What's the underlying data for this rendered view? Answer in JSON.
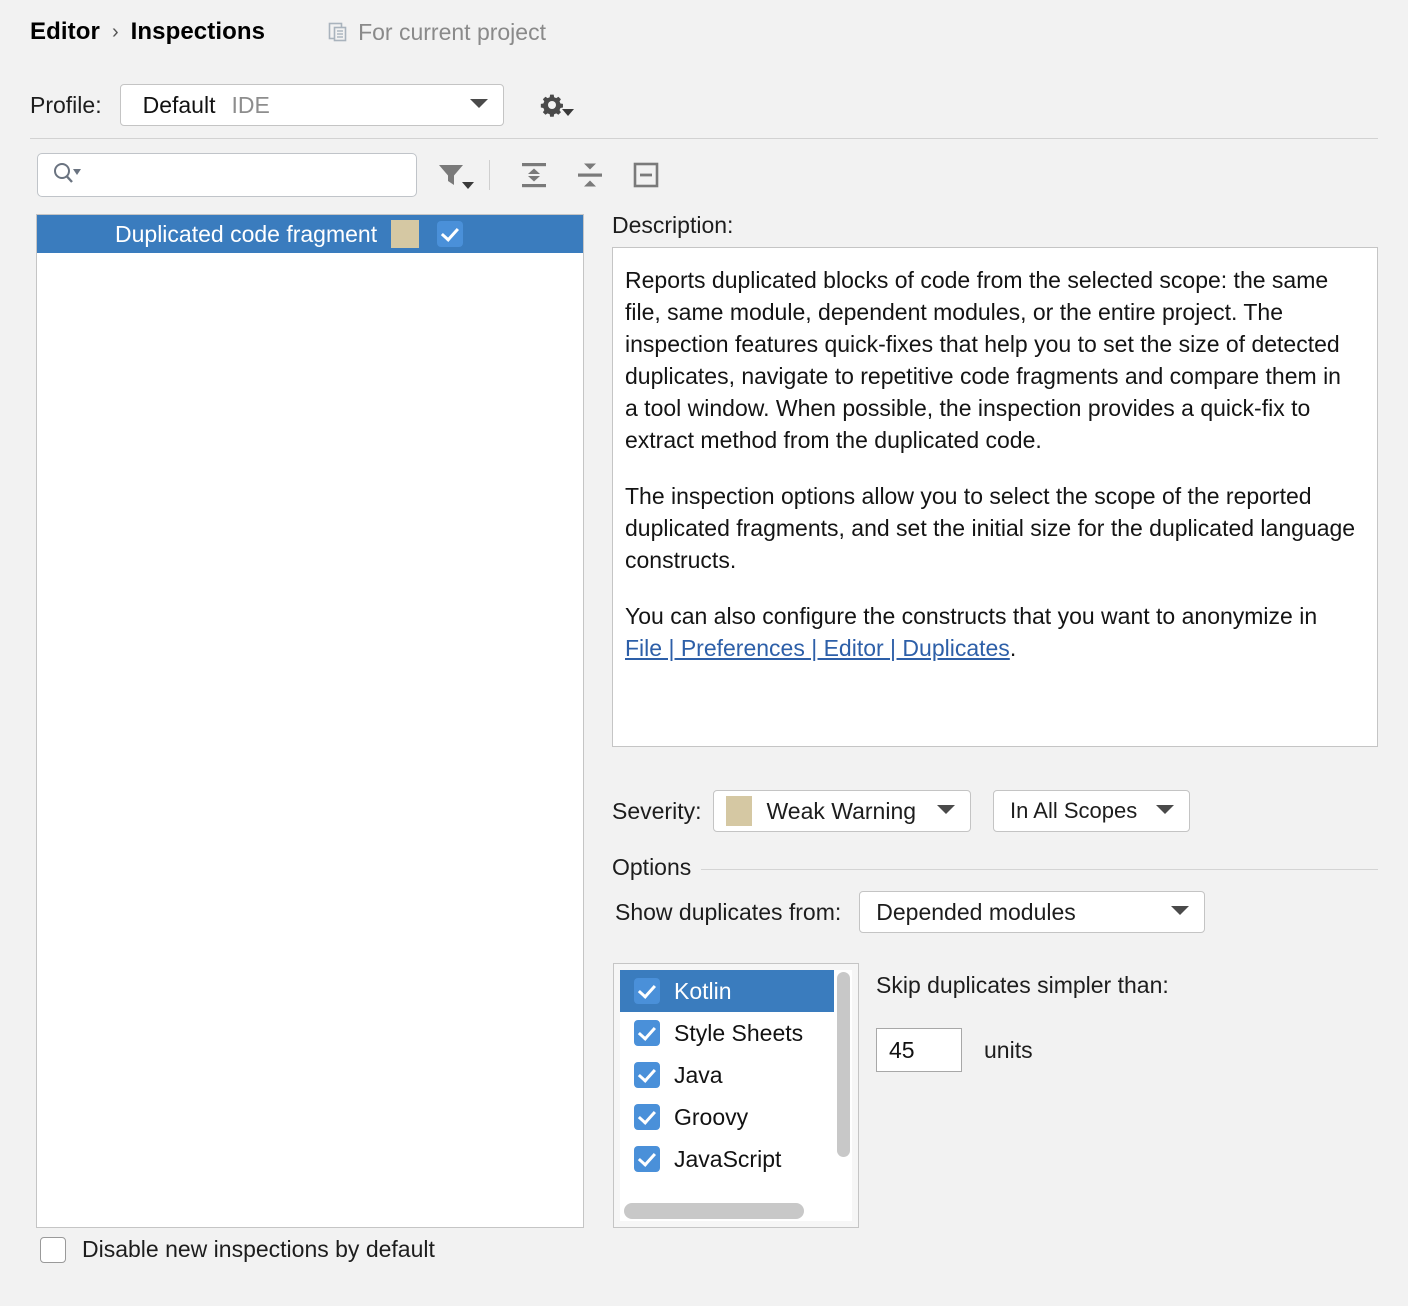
{
  "header": {
    "crumb_root": "Editor",
    "crumb_separator": "›",
    "crumb_current": "Inspections",
    "scope_note": "For current project",
    "scope_note_icon": "project-copy-icon"
  },
  "profile": {
    "label": "Profile:",
    "name": "Default",
    "kind": "IDE",
    "gear_icon": "gear-icon",
    "dropdown_icon": "chevron-down-icon"
  },
  "toolbar": {
    "search_value": "",
    "search_placeholder": "",
    "search_icon": "search-icon",
    "filter_icon": "filter-funnel-icon",
    "expand_all_icon": "expand-all-icon",
    "collapse_all_icon": "collapse-all-icon",
    "collapse_box_icon": "collapse-box-icon"
  },
  "tree": {
    "items": [
      {
        "label": "Duplicated code fragment",
        "selected": true,
        "severity_color": "#d5c8a3",
        "enabled": true
      }
    ]
  },
  "bottom": {
    "disable_new_label": "Disable new inspections by default",
    "disable_new_checked": false
  },
  "description": {
    "label": "Description:",
    "paragraphs": [
      "Reports duplicated blocks of code from the selected scope: the same file, same module, dependent modules, or the entire project. The inspection features quick-fixes that help you to set the size of detected duplicates, navigate to repetitive code fragments and compare them in a tool window. When possible, the inspection provides a quick-fix to extract method from the duplicated code.",
      "The inspection options allow you to select the scope of the reported duplicated fragments, and set the initial size for the duplicated language constructs."
    ],
    "last_paragraph_prefix": "You can also configure the constructs that you want to anonymize in ",
    "link_text": "File | Preferences | Editor | Duplicates",
    "last_paragraph_suffix": "."
  },
  "severity": {
    "label": "Severity:",
    "value": "Weak Warning",
    "swatch_color": "#d5c8a3",
    "scope_value": "In All Scopes"
  },
  "options": {
    "title": "Options",
    "show_duplicates_label": "Show duplicates from:",
    "show_duplicates_value": "Depended modules",
    "languages": [
      {
        "name": "Kotlin",
        "checked": true,
        "selected": true
      },
      {
        "name": "Style Sheets",
        "checked": true,
        "selected": false
      },
      {
        "name": "Java",
        "checked": true,
        "selected": false
      },
      {
        "name": "Groovy",
        "checked": true,
        "selected": false
      },
      {
        "name": "JavaScript",
        "checked": true,
        "selected": false
      }
    ],
    "skip_label": "Skip duplicates simpler than:",
    "skip_value": "45",
    "units_label": "units"
  },
  "colors": {
    "selection_blue": "#3a7cbe",
    "checkbox_blue": "#4a90d9",
    "link_blue": "#2d5fa8",
    "background": "#f2f2f2",
    "severity_tan": "#d5c8a3"
  }
}
